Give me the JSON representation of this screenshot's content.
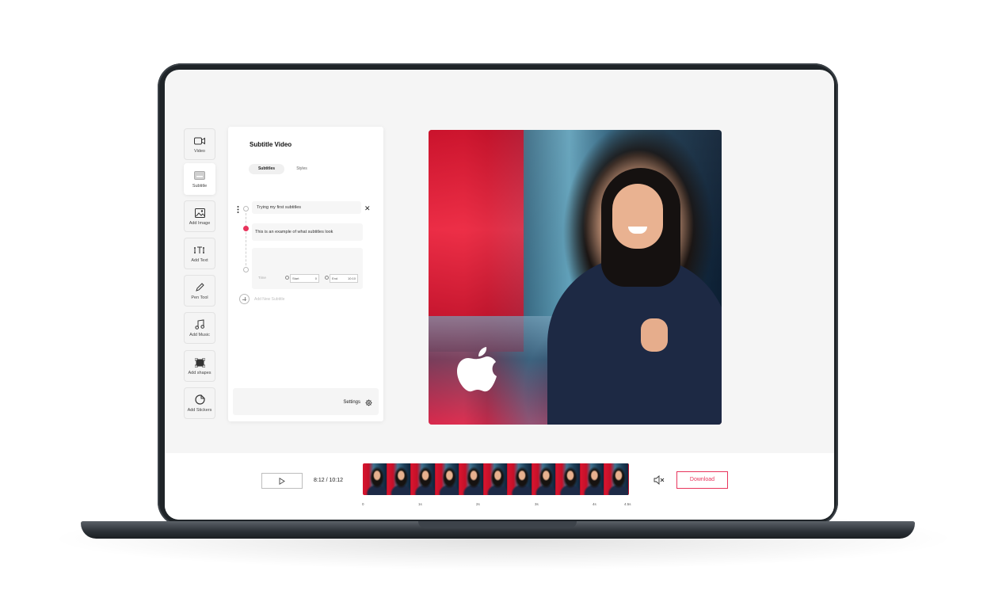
{
  "toolbar": {
    "items": [
      {
        "label": "Video",
        "icon": "video-camera-icon"
      },
      {
        "label": "Subtitle",
        "icon": "subtitle-icon"
      },
      {
        "label": "Add Image",
        "icon": "image-icon"
      },
      {
        "label": "Add Text",
        "icon": "text-icon"
      },
      {
        "label": "Pen Tool",
        "icon": "pen-icon"
      },
      {
        "label": "Add Music",
        "icon": "music-note-icon"
      },
      {
        "label": "Add shapes",
        "icon": "shape-icon"
      },
      {
        "label": "Add Stickers",
        "icon": "sticker-icon"
      }
    ],
    "active_index": 1
  },
  "panel": {
    "title": "Subtitle Video",
    "tabs": [
      "Subtitles",
      "Styles"
    ],
    "active_tab": "Subtitles",
    "subtitles": [
      "Trying my first subtitles",
      "This is an example of what subtitles look"
    ],
    "time": {
      "label": "Time",
      "start_label": "Start",
      "start_value": "0",
      "end_label": "End",
      "end_value": "10:10"
    },
    "add_new_label": "Add New Subtitle",
    "settings_label": "Settings"
  },
  "player": {
    "time_readout": "8:12 / 10:12",
    "ticks": [
      "0",
      "1s",
      "2s",
      "3s",
      "4s",
      "4.5s"
    ],
    "download_label": "Download"
  },
  "colors": {
    "accent": "#e8345c",
    "frame_dark": "#1f2428",
    "screen_bg": "#f5f5f5"
  }
}
